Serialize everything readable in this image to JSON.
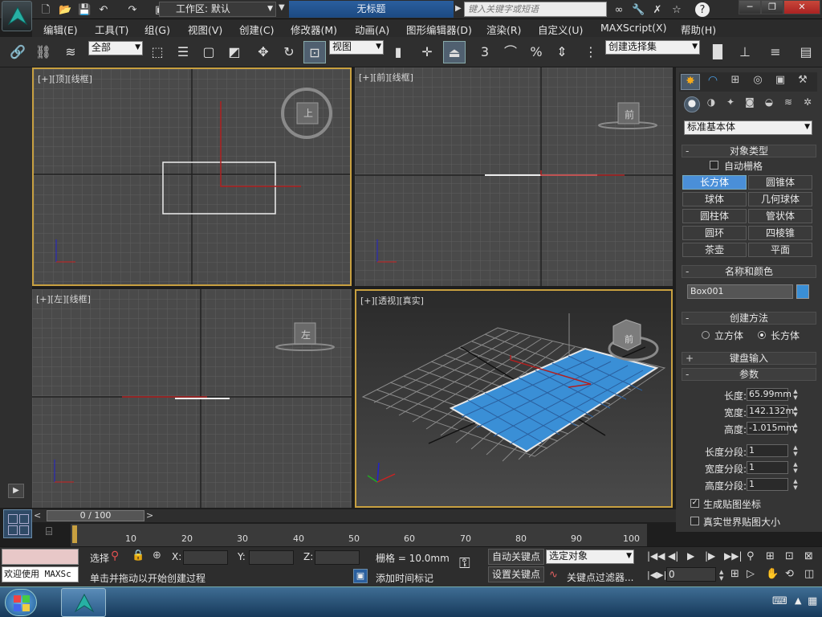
{
  "window": {
    "title": "无标题",
    "workspace_prefix": "工作区: ",
    "workspace": "默认",
    "search_placeholder": "键入关键字或短语"
  },
  "menubar": [
    "编辑(E)",
    "工具(T)",
    "组(G)",
    "视图(V)",
    "创建(C)",
    "修改器(M)",
    "动画(A)",
    "图形编辑器(D)",
    "渲染(R)",
    "自定义(U)",
    "MAXScript(X)",
    "帮助(H)"
  ],
  "toolbar": {
    "selection_filter": "全部",
    "ref_coord": "视图",
    "named_selection": "创建选择集",
    "snap_num": "3",
    "angle_snap": "⌒",
    "percent": "%"
  },
  "viewports": [
    {
      "label": "[+][顶][线框]",
      "cube_face": "上"
    },
    {
      "label": "[+][前][线框]",
      "cube_face": "前"
    },
    {
      "label": "[+][左][线框]",
      "cube_face": "左"
    },
    {
      "label": "[+][透视][真实]",
      "cube_face": "前"
    }
  ],
  "command_panel": {
    "category": "标准基本体",
    "object_type": {
      "title": "对象类型",
      "autogrid": "自动栅格",
      "buttons": [
        "长方体",
        "圆锥体",
        "球体",
        "几何球体",
        "圆柱体",
        "管状体",
        "圆环",
        "四棱锥",
        "茶壶",
        "平面"
      ],
      "selected": "长方体"
    },
    "name_color": {
      "title": "名称和颜色",
      "name": "Box001",
      "color": "#3a8fd6"
    },
    "creation_method": {
      "title": "创建方法",
      "options": [
        "立方体",
        "长方体"
      ],
      "selected": "长方体"
    },
    "keyboard_entry": {
      "title": "键盘输入"
    },
    "params": {
      "title": "参数",
      "length_label": "长度:",
      "length": "65.99mm",
      "width_label": "宽度:",
      "width": "142.132m",
      "height_label": "高度:",
      "height": "-1.015mm",
      "lseg_label": "长度分段:",
      "lseg": "1",
      "wseg_label": "宽度分段:",
      "wseg": "1",
      "hseg_label": "高度分段:",
      "hseg": "1",
      "gen_map": "生成贴图坐标",
      "real_world": "真实世界贴图大小"
    }
  },
  "timeline": {
    "frame": "0 / 100",
    "ticks": [
      "10",
      "20",
      "30",
      "40",
      "50",
      "60",
      "70",
      "80",
      "90",
      "100"
    ]
  },
  "status": {
    "maxscript": "欢迎使用 MAXSc",
    "select": "选择",
    "x_label": "X:",
    "y_label": "Y:",
    "z_label": "Z:",
    "grid": "栅格 = 10.0mm",
    "prompt": "单击并拖动以开始创建过程",
    "add_time_tag": "添加时间标记",
    "auto_key": "自动关键点",
    "set_key": "设置关键点",
    "key_mode": "选定对象",
    "key_filter": "关键点过滤器...",
    "current_frame": "0"
  },
  "colors": {
    "accent": "#4a8fd8",
    "selected_object": "#3a8fd6",
    "viewport_bg": "#4a4a4a",
    "active_border": "#c8a040"
  }
}
